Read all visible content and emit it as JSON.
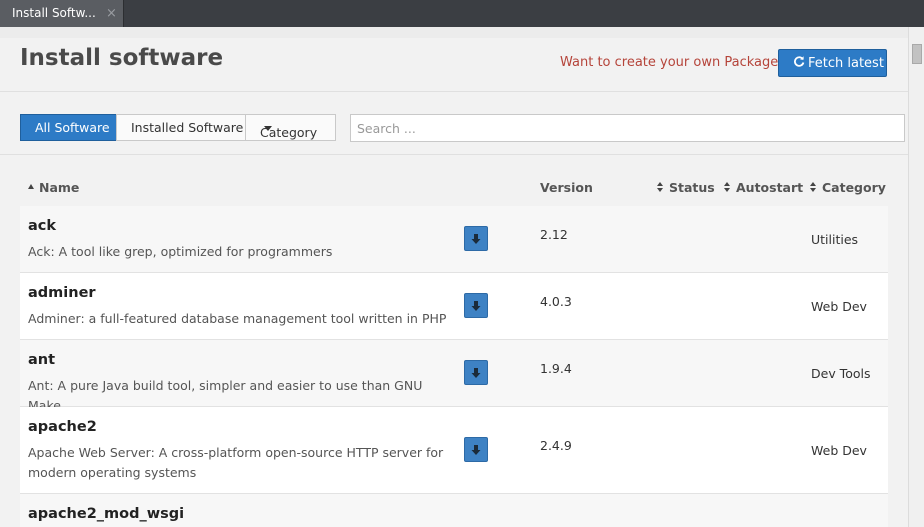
{
  "tab": {
    "title": "Install Softw...",
    "close": "×"
  },
  "header": {
    "title": "Install software",
    "create_link": "Want to create your own Packages?",
    "fetch_label": "Fetch latest",
    "fetch_icon": "refresh-icon"
  },
  "filters": {
    "all": "All Software",
    "installed": "Installed Software",
    "category": "Category",
    "active": "All Software",
    "search_placeholder": "Search ..."
  },
  "columns": {
    "name": "Name",
    "version": "Version",
    "status": "Status",
    "autostart": "Autostart",
    "category": "Category"
  },
  "packages": [
    {
      "name": "ack",
      "desc": "Ack: A tool like grep, optimized for programmers",
      "version": "2.12",
      "category": "Utilities"
    },
    {
      "name": "adminer",
      "desc": "Adminer: a full-featured database management tool written in PHP",
      "version": "4.0.3",
      "category": "Web Dev"
    },
    {
      "name": "ant",
      "desc": "Ant: A pure Java build tool, simpler and easier to use than GNU Make",
      "version": "1.9.4",
      "category": "Dev Tools"
    },
    {
      "name": "apache2",
      "desc": "Apache Web Server: A cross-platform open-source HTTP server for modern operating systems",
      "version": "2.4.9",
      "category": "Web Dev"
    },
    {
      "name": "apache2_mod_wsgi",
      "desc": "",
      "version": "",
      "category": ""
    }
  ],
  "colors": {
    "accent": "#2d7bc6",
    "link": "#b5443a",
    "download": "#3e82c4"
  }
}
